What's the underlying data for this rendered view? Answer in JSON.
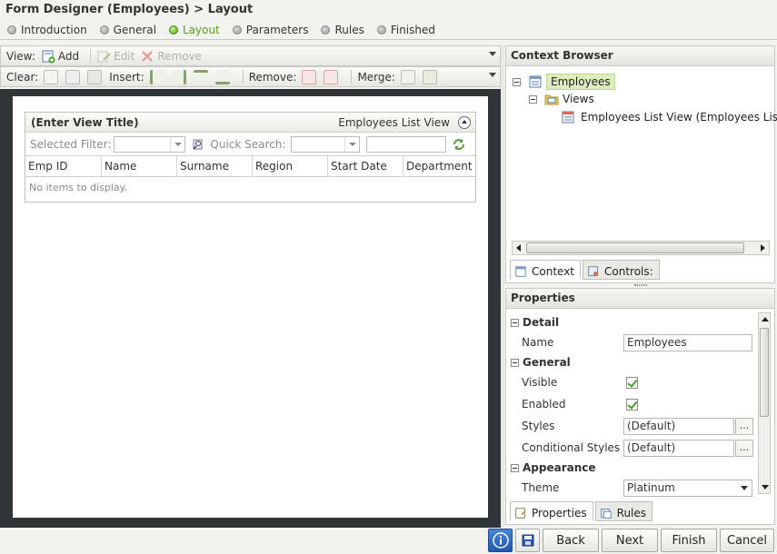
{
  "title": "Form Designer (Employees) > Layout",
  "steps": [
    {
      "label": "Introduction",
      "active": false
    },
    {
      "label": "General",
      "active": false
    },
    {
      "label": "Layout",
      "active": true
    },
    {
      "label": "Parameters",
      "active": false
    },
    {
      "label": "Rules",
      "active": false
    },
    {
      "label": "Finished",
      "active": false
    }
  ],
  "toolbar1": {
    "view_label": "View:",
    "add_label": "Add",
    "edit_label": "Edit",
    "remove_label": "Remove"
  },
  "toolbar2": {
    "clear_label": "Clear:",
    "insert_label": "Insert:",
    "remove_label": "Remove:",
    "merge_label": "Merge:"
  },
  "listview": {
    "title": "(Enter View Title)",
    "view_name": "Employees List View",
    "selected_filter_label": "Selected Filter:",
    "quick_search_label": "Quick Search:",
    "columns": [
      "Emp ID",
      "Name",
      "Surname",
      "Region",
      "Start Date",
      "Department"
    ],
    "empty_text": "No items to display."
  },
  "context_browser": {
    "title": "Context Browser",
    "tree": {
      "root": "Employees",
      "views": "Views",
      "view_item": "Employees List View (Employees Lis"
    },
    "tabs": [
      "Context",
      "Controls:"
    ]
  },
  "properties": {
    "title": "Properties",
    "sections": {
      "detail": "Detail",
      "general": "General",
      "appearance": "Appearance"
    },
    "name_label": "Name",
    "name_value": "Employees",
    "visible_label": "Visible",
    "visible": true,
    "enabled_label": "Enabled",
    "enabled": true,
    "styles_label": "Styles",
    "styles_value": "(Default)",
    "cond_styles_label": "Conditional Styles",
    "cond_styles_value": "(Default)",
    "theme_label": "Theme",
    "theme_value": "Platinum",
    "ellipsis": "...",
    "tabs": [
      "Properties",
      "Rules"
    ]
  },
  "footer": {
    "back": "Back",
    "next": "Next",
    "finish": "Finish",
    "cancel": "Cancel"
  },
  "colors": {
    "accent_green": "#5aa020",
    "canvas_dark": "#2f3437",
    "info_blue": "#2a62c4"
  }
}
